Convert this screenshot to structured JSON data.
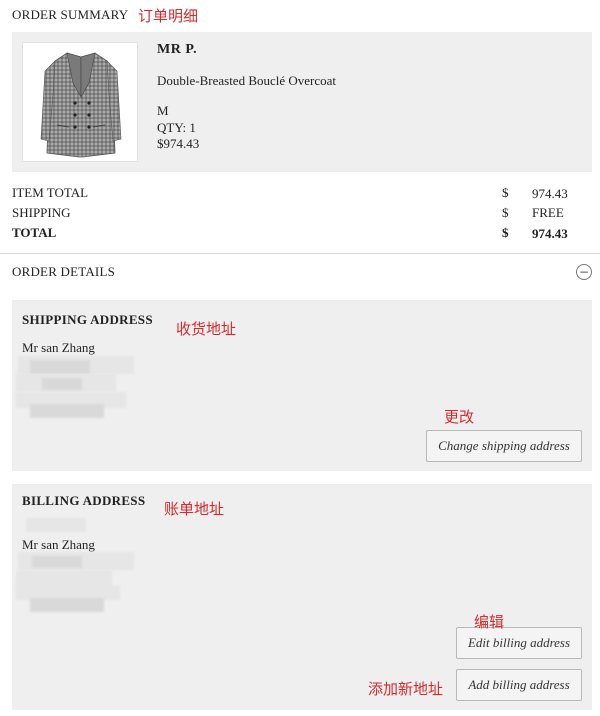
{
  "order_summary": {
    "heading": "ORDER SUMMARY",
    "annotation": "订单明细"
  },
  "product": {
    "brand": "MR P.",
    "name": "Double-Breasted Bouclé Overcoat",
    "size": "M",
    "qty": "QTY: 1",
    "price": "$974.43"
  },
  "totals": [
    {
      "label": "ITEM TOTAL",
      "currency": "$",
      "value": "974.43",
      "bold": false
    },
    {
      "label": "SHIPPING",
      "currency": "$",
      "value": "FREE",
      "bold": false
    },
    {
      "label": "TOTAL",
      "currency": "$",
      "value": "974.43",
      "bold": true
    }
  ],
  "order_details": {
    "heading": "ORDER DETAILS",
    "collapse_symbol": "−"
  },
  "shipping": {
    "title": "SHIPPING ADDRESS",
    "annotation": "收货地址",
    "name": "Mr san Zhang",
    "change_annotation": "更改",
    "change_button": "Change shipping address"
  },
  "billing": {
    "title": "BILLING ADDRESS",
    "annotation": "账单地址",
    "name": "Mr san Zhang",
    "edit_annotation": "编辑",
    "edit_button": "Edit billing address",
    "add_annotation": "添加新地址",
    "add_button": "Add billing address"
  },
  "colors": {
    "annotation_red": "#d62b2b",
    "panel_bg": "#efefef"
  }
}
